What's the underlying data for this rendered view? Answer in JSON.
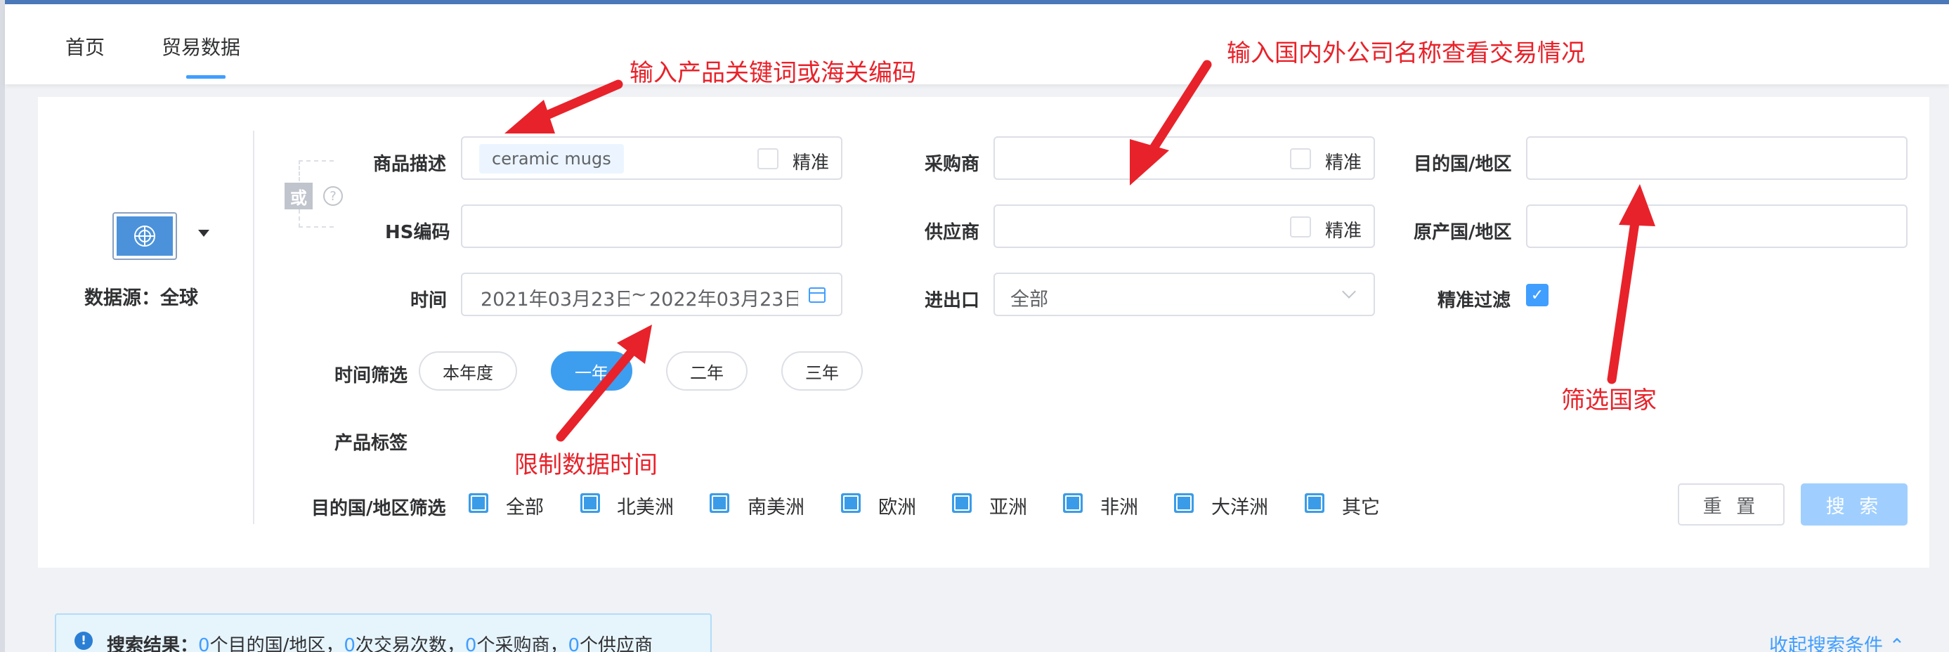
{
  "nav": {
    "tabs": [
      "首页",
      "贸易数据"
    ],
    "active_index": 1
  },
  "datasource": {
    "label": "数据源：全球",
    "flag_icon": "un-flag-icon"
  },
  "form": {
    "or_label": "或",
    "product_desc": {
      "label": "商品描述",
      "tag": "ceramic mugs",
      "exact_label": "精准"
    },
    "hs_code": {
      "label": "HS编码",
      "value": ""
    },
    "time": {
      "label": "时间",
      "start": "2021年03月23日",
      "sep": "~",
      "end": "2022年03月23日"
    },
    "buyer": {
      "label": "采购商",
      "value": "",
      "exact_label": "精准"
    },
    "supplier": {
      "label": "供应商",
      "value": "",
      "exact_label": "精准"
    },
    "import_export": {
      "label": "进出口",
      "value": "全部"
    },
    "dest_country": {
      "label": "目的国/地区",
      "value": ""
    },
    "origin_country": {
      "label": "原产国/地区",
      "value": ""
    },
    "exact_filter": {
      "label": "精准过滤",
      "checked": true
    },
    "time_filter": {
      "label": "时间筛选",
      "options": [
        "本年度",
        "一年",
        "二年",
        "三年"
      ],
      "active": "一年"
    },
    "product_tags": {
      "label": "产品标签"
    },
    "region_filter": {
      "label": "目的国/地区筛选",
      "options": [
        "全部",
        "北美洲",
        "南美洲",
        "欧洲",
        "亚洲",
        "非洲",
        "大洋洲",
        "其它"
      ]
    },
    "reset_label": "重 置",
    "search_label": "搜 索"
  },
  "annotations": {
    "product": "输入产品关键词或海关编码",
    "company": "输入国内外公司名称查看交易情况",
    "country": "筛选国家",
    "time": "限制数据时间",
    "color": "#e8222a"
  },
  "results": {
    "prefix": "搜索结果：",
    "dest_count": "0",
    "dest_suffix": "个目的国/地区，",
    "trade_count": "0",
    "trade_suffix": "次交易次数，",
    "buyer_count": "0",
    "buyer_suffix": "个采购商，",
    "supplier_count": "0",
    "supplier_suffix": "个供应商"
  },
  "collapse_label": "收起搜索条件",
  "colors": {
    "accent": "#409eff",
    "annotation": "#e8222a",
    "pill_active": "#3d9ef0"
  }
}
